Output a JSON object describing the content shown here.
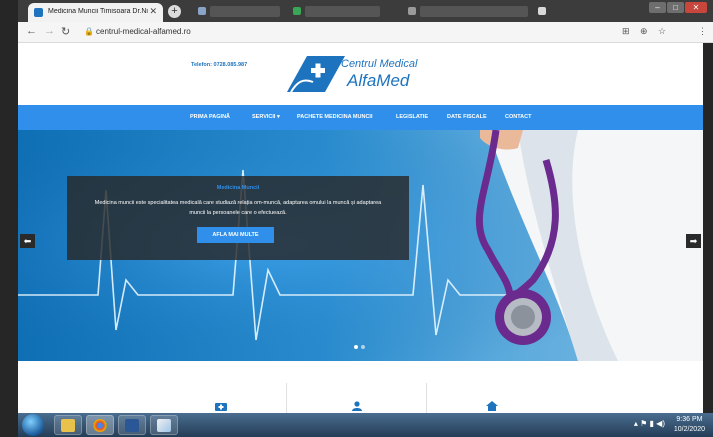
{
  "browser": {
    "active_tab_title": "Medicina Muncii Timisoara Dr.Ni",
    "new_tab_symbol": "+",
    "url": "centrul-medical-alfamed.ro"
  },
  "site": {
    "phone": "Telefon: 0728.085.987",
    "logo_line1": "Centrul Medical",
    "logo_line2": "AlfaMed",
    "accent_color": "#2f8fea",
    "nav": [
      {
        "label": "PRIMA PAGINĂ"
      },
      {
        "label": "SERVICII ▾"
      },
      {
        "label": "PACHETE MEDICINA MUNCII"
      },
      {
        "label": "LEGISLATIE"
      },
      {
        "label": "DATE FISCALE"
      },
      {
        "label": "CONTACT"
      }
    ],
    "hero": {
      "title": "Medicina Muncii",
      "text": "Medicina muncii este specialitatea medicală care studiază relația om-muncă, adaptarea omului la muncă și adaptarea muncii la persoanele care o efectuează.",
      "button": "AFLA MAI MULTE"
    }
  },
  "taskbar": {
    "clock_time": "9:36 PM",
    "clock_date": "10/2/2020"
  }
}
